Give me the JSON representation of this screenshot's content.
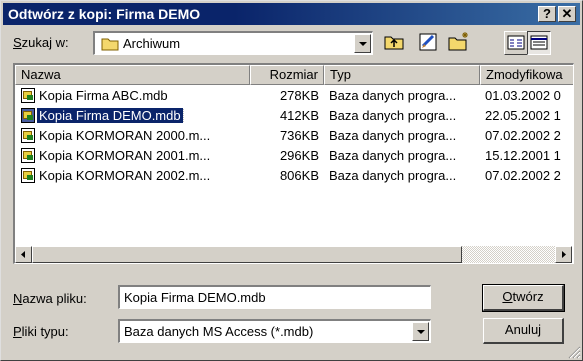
{
  "dialog": {
    "title": "Odtwórz z kopi: Firma DEMO",
    "help_button": "?",
    "close_button": "✕"
  },
  "lookin": {
    "label_prefix": "S",
    "label_rest": "zukaj w:",
    "value": "Archiwum"
  },
  "columns": {
    "name": "Nazwa",
    "size": "Rozmiar",
    "type": "Typ",
    "modified": "Zmodyfikowa"
  },
  "files": [
    {
      "name": "Kopia Firma ABC.mdb",
      "size": "278KB",
      "type": "Baza danych progra...",
      "modified": "01.03.2002 0"
    },
    {
      "name": "Kopia Firma DEMO.mdb",
      "size": "412KB",
      "type": "Baza danych progra...",
      "modified": "22.05.2002 1"
    },
    {
      "name": "Kopia KORMORAN 2000.m...",
      "size": "736KB",
      "type": "Baza danych progra...",
      "modified": "07.02.2002 2"
    },
    {
      "name": "Kopia KORMORAN 2001.m...",
      "size": "296KB",
      "type": "Baza danych progra...",
      "modified": "15.12.2001 1"
    },
    {
      "name": "Kopia KORMORAN 2002.m...",
      "size": "806KB",
      "type": "Baza danych progra...",
      "modified": "07.02.2002 2"
    }
  ],
  "selected_index": 1,
  "filename": {
    "label_prefix": "N",
    "label_rest": "azwa pliku:",
    "value": "Kopia Firma DEMO.mdb"
  },
  "filetype": {
    "label_prefix": "P",
    "label_rest": "liki typu:",
    "value": "Baza danych MS Access (*.mdb)"
  },
  "buttons": {
    "open_prefix": "O",
    "open_rest": "twórz",
    "cancel": "Anuluj"
  },
  "icons": [
    "folder-icon",
    "up-folder-icon",
    "favorites-icon",
    "new-folder-icon",
    "list-view-icon",
    "details-view-icon",
    "file-icon"
  ],
  "colors": {
    "title_bar": "#0a246a",
    "selection": "#0a246a",
    "face": "#d4d0c8"
  }
}
